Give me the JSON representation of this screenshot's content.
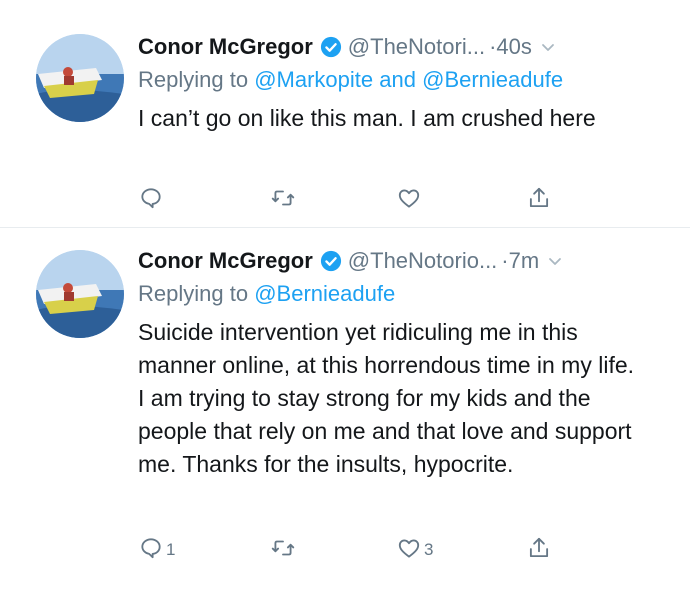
{
  "tweets": [
    {
      "name": "Conor McGregor",
      "handle": "@TheNotori...",
      "dot": "·",
      "time": "40s",
      "replying_prefix": "Replying to",
      "mentions_1": "@Markopite",
      "mentions_join": "and",
      "mentions_2": "@Bernieadufe",
      "text": "I can’t go on like this man. I am crushed here",
      "reply_count": "",
      "like_count": ""
    },
    {
      "name": "Conor McGregor",
      "handle": "@TheNotorio...",
      "dot": "·",
      "time": "7m",
      "replying_prefix": "Replying to",
      "mentions_1": "@Bernieadufe",
      "text": "Suicide intervention yet ridiculing me in this manner online, at this horrendous time in my life. I am trying to stay strong for my kids and the people that rely on me and that love and support me. Thanks for the insults, hypocrite.",
      "reply_count": "1",
      "like_count": "3"
    }
  ],
  "icons": {
    "verified": "verified-badge-icon",
    "menu": "chevron-down-icon",
    "reply": "reply-icon",
    "retweet": "retweet-icon",
    "like": "heart-icon",
    "share": "share-icon"
  },
  "colors": {
    "text": "#14171a",
    "secondary": "#657786",
    "link": "#1da1f2",
    "verified": "#1da1f2",
    "divider": "#e8ecef"
  }
}
